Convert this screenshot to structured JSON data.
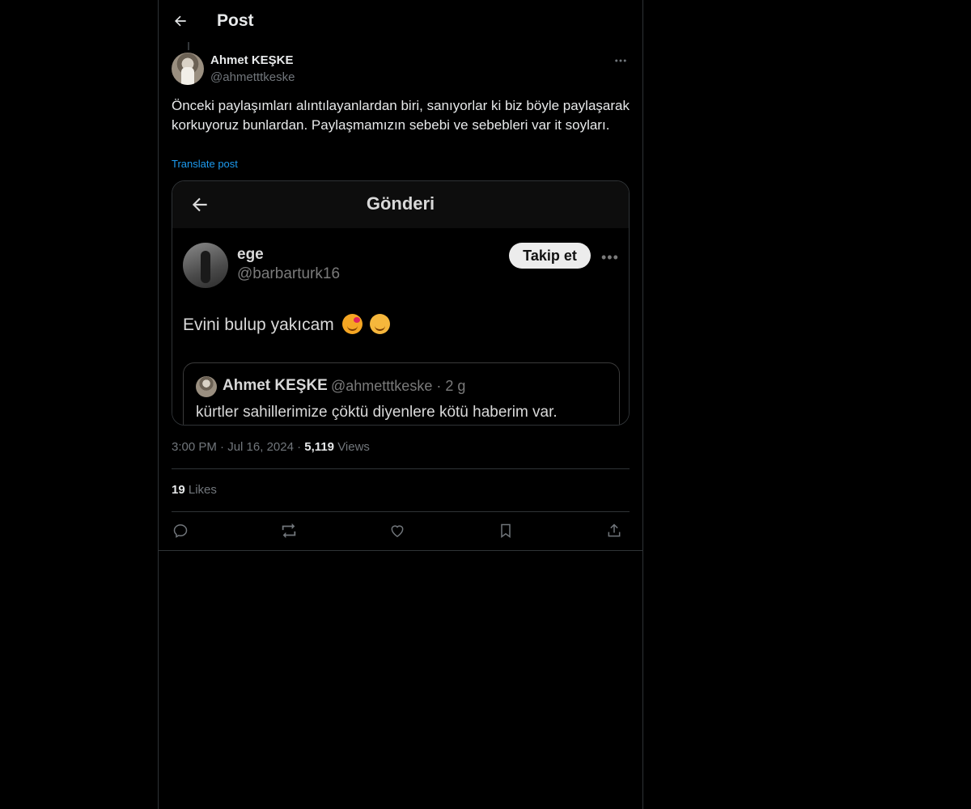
{
  "header": {
    "title": "Post"
  },
  "post": {
    "author_name": "Ahmet KEŞKE",
    "author_handle": "@ahmetttkeske",
    "text": "Önceki paylaşımları alıntılayanlardan biri, sanıyorlar ki biz böyle paylaşarak korkuyoruz bunlardan. Paylaşmamızın sebebi ve sebebleri var it soyları.",
    "translate_label": "Translate post",
    "time": "3:00 PM",
    "date": "Jul 16, 2024",
    "views_count": "5,119",
    "views_label": "Views",
    "likes_count": "19",
    "likes_label": "Likes"
  },
  "embedded_screenshot": {
    "title": "Gönderi",
    "user_name": "ege",
    "user_handle": "@barbarturk16",
    "follow_label": "Takip et",
    "text": "Evini bulup yakıcam",
    "emojis": [
      "smiling-face-with-hearts",
      "hugging-face"
    ],
    "quote": {
      "name": "Ahmet KEŞKE",
      "meta": "@ahmetttkeske · 2 g",
      "text": "kürtler sahillerimize çöktü diyenlere kötü haberim var."
    }
  },
  "icons": {
    "back": "back-arrow-icon",
    "more": "more-icon",
    "reply": "reply-icon",
    "repost": "repost-icon",
    "like": "heart-icon",
    "bookmark": "bookmark-icon",
    "share": "share-icon"
  },
  "colors": {
    "background": "#000000",
    "text": "#e7e9ea",
    "secondary": "#71767b",
    "accent": "#1d9bf0",
    "border": "#2f3336"
  }
}
